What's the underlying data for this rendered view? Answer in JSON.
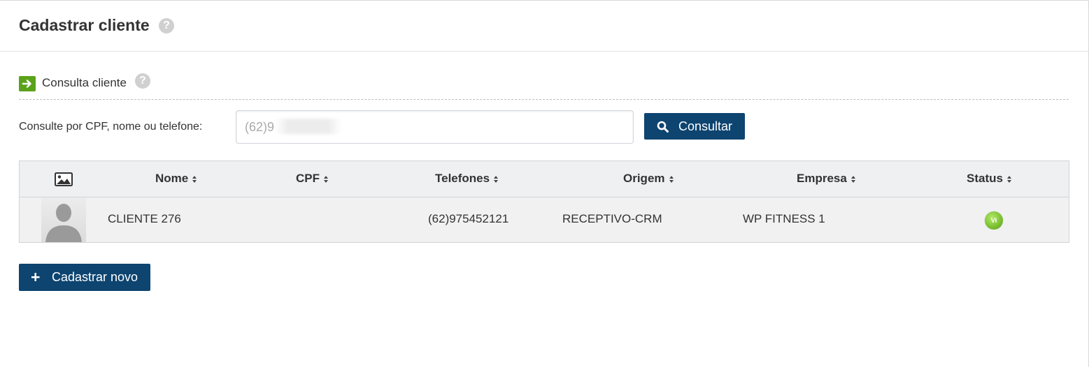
{
  "page": {
    "title": "Cadastrar cliente",
    "help_glyph": "?"
  },
  "section": {
    "label": "Consulta cliente",
    "help_glyph": "?"
  },
  "search": {
    "label": "Consulte por CPF, nome ou telefone:",
    "value": "(62)9",
    "button_label": "Consultar"
  },
  "table": {
    "columns": [
      "Nome",
      "CPF",
      "Telefones",
      "Origem",
      "Empresa",
      "Status"
    ],
    "rows": [
      {
        "nome": "CLIENTE 276",
        "cpf": "",
        "telefones": "(62)975452121",
        "origem": "RECEPTIVO-CRM",
        "empresa": "WP FITNESS 1",
        "status": "VI"
      }
    ]
  },
  "actions": {
    "new_label": "Cadastrar novo"
  },
  "colors": {
    "primary": "#0d4470",
    "accent_green": "#5aa21a",
    "status_green": "#7ec232"
  },
  "icons": {
    "help": "question-circle-icon",
    "arrow": "arrow-right-icon",
    "search": "search-icon",
    "image": "image-icon",
    "sort": "sort-icon",
    "plus": "plus-icon",
    "avatar": "user-silhouette-icon"
  }
}
